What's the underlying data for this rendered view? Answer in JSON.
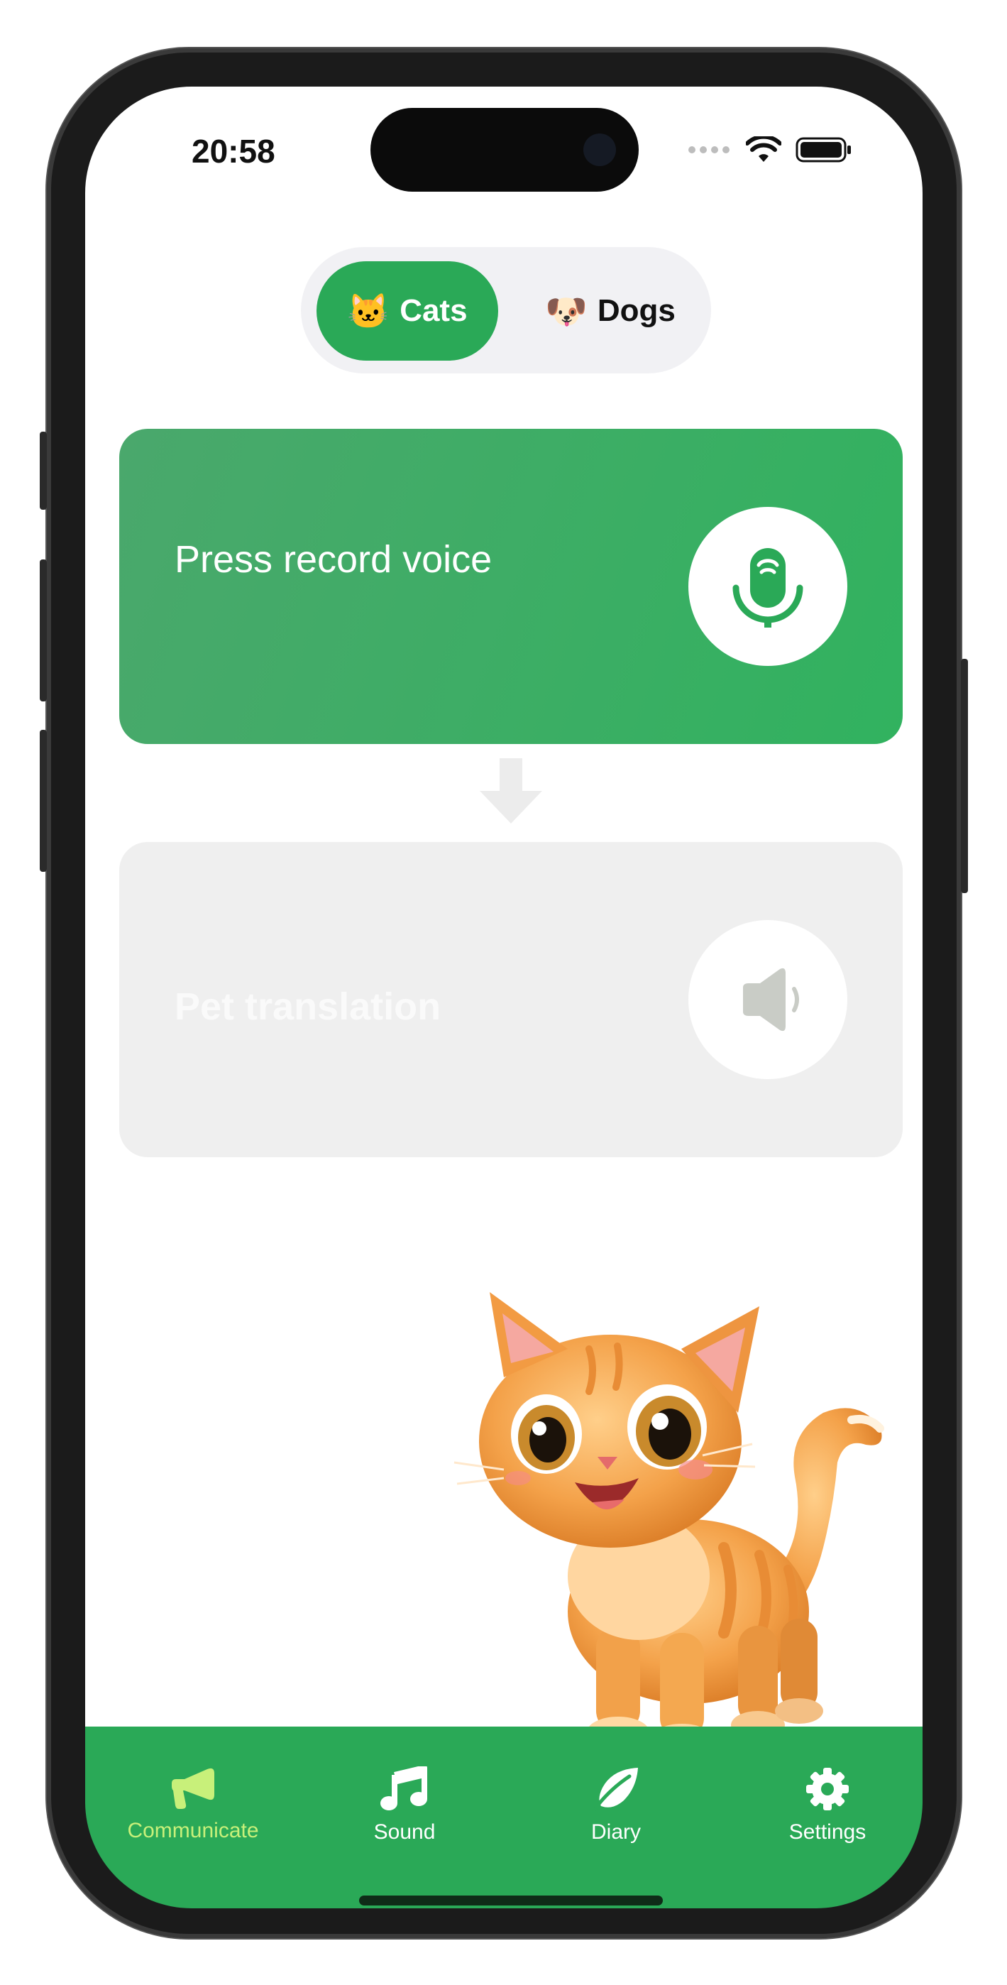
{
  "status_bar": {
    "time": "20:58",
    "icons": [
      "signal-dots-icon",
      "wifi-icon",
      "battery-icon"
    ]
  },
  "segment": {
    "cats": {
      "emoji": "🐱",
      "label": "Cats",
      "selected": true
    },
    "dogs": {
      "emoji": "🐶",
      "label": "Dogs",
      "selected": false
    }
  },
  "record_card": {
    "label": "Press record voice",
    "icon": "microphone-icon"
  },
  "translation_card": {
    "label": "Pet translation",
    "icon": "speaker-icon"
  },
  "illustration": "cat-illustration",
  "tabbar": {
    "items": [
      {
        "label": "Communicate",
        "icon": "megaphone-icon",
        "active": true
      },
      {
        "label": "Sound",
        "icon": "music-note-icon",
        "active": false
      },
      {
        "label": "Diary",
        "icon": "leaf-icon",
        "active": false
      },
      {
        "label": "Settings",
        "icon": "gear-icon",
        "active": false
      }
    ]
  },
  "colors": {
    "accent": "#2aa957",
    "active_tab": "#c8f07a",
    "card_inactive": "#efefef"
  }
}
